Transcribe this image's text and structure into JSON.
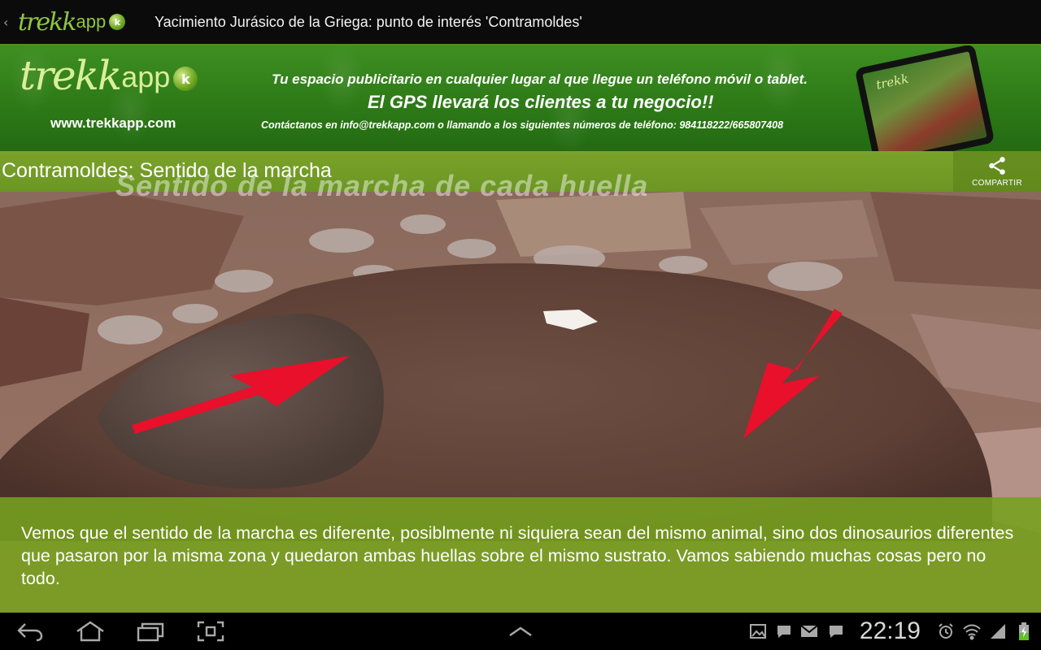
{
  "action_bar": {
    "logo_script": "trekk",
    "logo_app": "app",
    "logo_badge": "k",
    "title": "Yacimiento Jurásico de la Griega: punto de interés 'Contramoldes'"
  },
  "banner": {
    "logo_script": "trekk",
    "logo_app": "app",
    "logo_badge": "k",
    "url": "www.trekkapp.com",
    "line1": "Tu espacio publicitario en cualquier lugar al que llegue un teléfono móvil o tablet.",
    "line2": "El GPS llevará los clientes a tu negocio!!",
    "line3": "Contáctanos en info@trekkapp.com o llamando a los siguientes números de teléfono: 984118222/665807408"
  },
  "content": {
    "section_title": "Contramoldes: Sentido de la marcha",
    "image_caption": "Sentido de la marcha de cada huella",
    "share_label": "COMPARTIR",
    "description": "Vemos que el sentido de la marcha es diferente, posiblmente ni siquiera sean del mismo animal, sino dos dinosaurios diferentes que pasaron por la misma zona y quedaron ambas huellas sobre el mismo sustrato. Vamos sabiendo muchas cosas pero no todo."
  },
  "system_bar": {
    "clock": "22:19"
  },
  "colors": {
    "accent_green": "#4f8f1f",
    "banner_green": "#2f7c18",
    "overlay_green": "#76a01e",
    "arrow_red": "#e8102a"
  }
}
